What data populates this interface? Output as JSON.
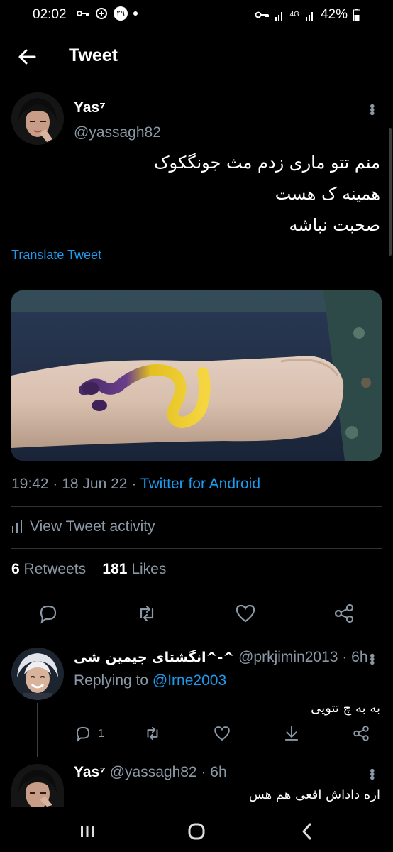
{
  "status_bar": {
    "time": "02:02",
    "battery": "42%",
    "network": "4G",
    "notification_badge": "۲۹"
  },
  "header": {
    "title": "Tweet"
  },
  "tweet": {
    "display_name": "Yas⁷",
    "handle": "@yassagh82",
    "text_lines": [
      "منم تتو ماری زدم مث جونگکوک",
      "همینه ک هست",
      "صحبت نباشه"
    ],
    "translate_label": "Translate Tweet",
    "time": "19:42",
    "date": "18 Jun 22",
    "source": "Twitter for Android",
    "activity_label": "View Tweet activity",
    "retweets_count": "6",
    "retweets_label": "Retweets",
    "likes_count": "181",
    "likes_label": "Likes"
  },
  "actions": {
    "icons": [
      "reply-icon",
      "retweet-icon",
      "like-icon",
      "share-icon"
    ]
  },
  "replies": [
    {
      "display_name": "انگشتای جیمین شی^-^",
      "handle": "@prkjimin2013",
      "time": "6h",
      "replying_to_label": "Replying to",
      "replying_to": "@Irne2003",
      "text": "به به چ تتویی",
      "reply_count": "1"
    },
    {
      "display_name": "Yas⁷",
      "handle": "@yassagh82",
      "time": "6h",
      "text": "اره داداش افعی هم هس"
    }
  ],
  "colors": {
    "background": "#000000",
    "accent": "#1d9bf0",
    "muted": "#8b98a5",
    "divider": "#2f3336"
  }
}
